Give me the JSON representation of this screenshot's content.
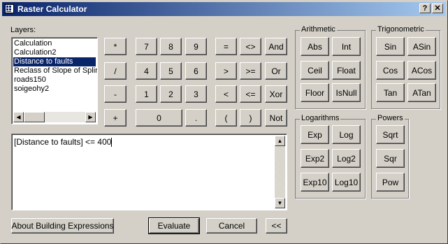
{
  "window": {
    "title": "Raster Calculator",
    "help_label": "?",
    "close_label": "✕"
  },
  "layers": {
    "label": "Layers:",
    "items": [
      "Calculation",
      "Calculation2",
      "Distance to faults",
      "Reclass of Slope of Splin",
      "roads150",
      "soigeohy2"
    ],
    "selected_index": 2
  },
  "keypad": {
    "multiply": "*",
    "divide": "/",
    "subtract": "-",
    "add": "+",
    "d7": "7",
    "d8": "8",
    "d9": "9",
    "d4": "4",
    "d5": "5",
    "d6": "6",
    "d1": "1",
    "d2": "2",
    "d3": "3",
    "d0": "0",
    "dot": ".",
    "eq": "=",
    "ne": "<>",
    "gt": ">",
    "ge": ">=",
    "lt": "<",
    "le": "<=",
    "lparen": "(",
    "rparen": ")",
    "and": "And",
    "or": "Or",
    "xor": "Xor",
    "not": "Not"
  },
  "arithmetic": {
    "label": "Arithmetic",
    "abs": "Abs",
    "int": "Int",
    "ceil": "Ceil",
    "float": "Float",
    "floor": "Floor",
    "isnull": "IsNull"
  },
  "trigonometric": {
    "label": "Trigonometric",
    "sin": "Sin",
    "asin": "ASin",
    "cos": "Cos",
    "acos": "ACos",
    "tan": "Tan",
    "atan": "ATan"
  },
  "logarithms": {
    "label": "Logarithms",
    "exp": "Exp",
    "log": "Log",
    "exp2": "Exp2",
    "log2": "Log2",
    "exp10": "Exp10",
    "log10": "Log10"
  },
  "powers": {
    "label": "Powers",
    "sqrt": "Sqrt",
    "sqr": "Sqr",
    "pow": "Pow"
  },
  "expression": {
    "value": "[Distance to faults] <= 400"
  },
  "footer": {
    "about": "About Building Expressions",
    "evaluate": "Evaluate",
    "cancel": "Cancel",
    "collapse": "<<"
  }
}
